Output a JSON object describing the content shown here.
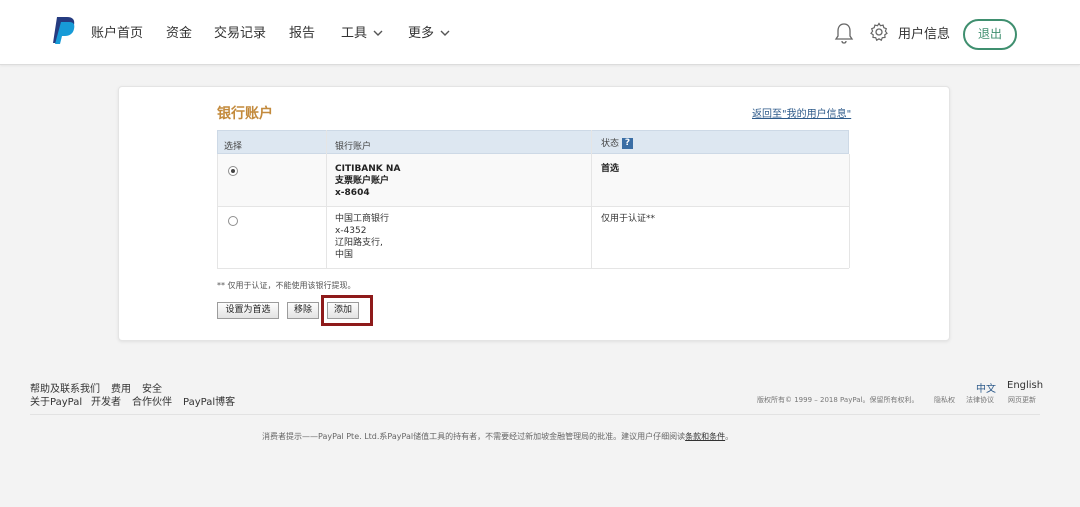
{
  "header": {
    "nav": [
      "账户首页",
      "资金",
      "交易记录",
      "报告",
      "工具",
      "更多"
    ],
    "user_info": "用户信息",
    "logout": "退出",
    "brand_color": "#253b80",
    "accent_color": "#3f8f6f"
  },
  "card": {
    "title": "银行账户",
    "back_link": "返回至\"我的用户信息\"",
    "columns": [
      "选择",
      "银行账户",
      "状态"
    ],
    "status_help_icon": "help-icon",
    "rows": [
      {
        "selected": true,
        "bank_lines": [
          "CITIBANK NA",
          "支票账户账户",
          "x-8604"
        ],
        "status": "首选"
      },
      {
        "selected": false,
        "bank_lines": [
          "中国工商银行",
          "x-4352",
          "辽阳路支行,",
          "中国"
        ],
        "status": "仅用于认证**"
      }
    ],
    "note": "** 仅用于认证，不能使用该银行提现。",
    "buttons": {
      "set_primary": "设置为首选",
      "remove": "移除",
      "add": "添加"
    }
  },
  "footer": {
    "links_row1": [
      "帮助及联系我们",
      "费用",
      "安全"
    ],
    "links_row2": [
      "关于PayPal",
      "开发者",
      "合作伙伴",
      "PayPal博客"
    ],
    "lang_current": "中文",
    "lang_other": "English",
    "copyright": "版权所有© 1999 – 2018 PayPal。保留所有权利。",
    "legal_links": [
      "隐私权",
      "法律协议",
      "网页更新"
    ],
    "disclaimer_pre": "消费者提示——PayPal Pte. Ltd.系PayPal储值工具的持有者，不需要经过新加坡金融管理局的批准。建议用户仔细阅读",
    "disclaimer_link": "条款和条件",
    "disclaimer_post": "。"
  }
}
